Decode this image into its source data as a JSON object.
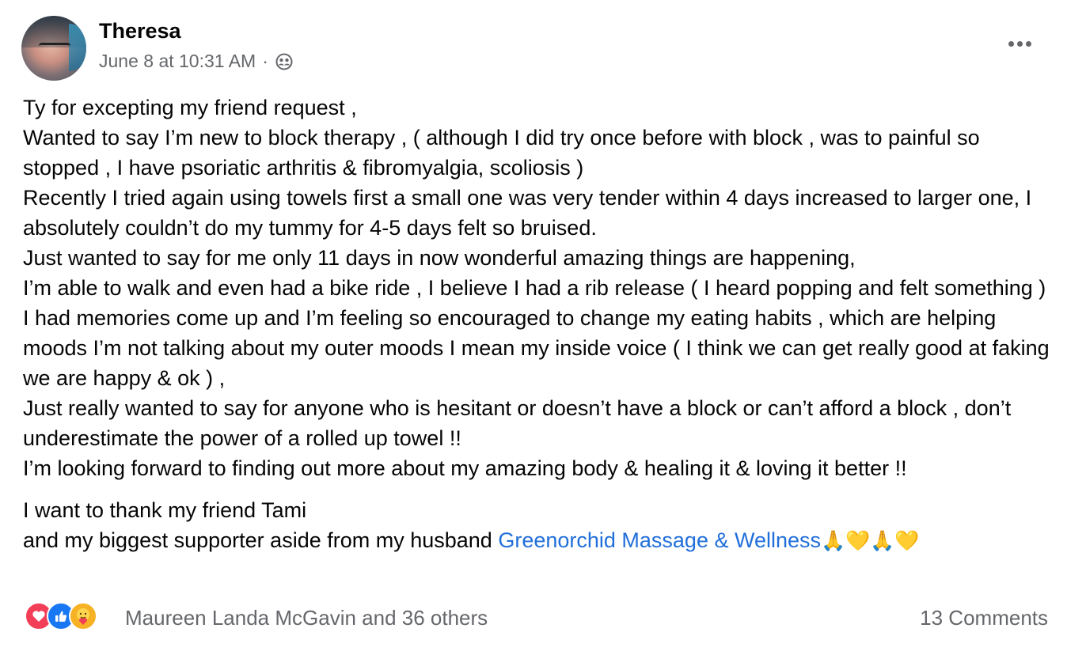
{
  "header": {
    "author": "Theresa",
    "timestamp": "June 8 at 10:31 AM",
    "separator": "·",
    "audience_icon": "friends-icon",
    "more_icon": "more-options-icon"
  },
  "body": {
    "lines": [
      "Ty for excepting my friend request ,",
      "Wanted to say I’m new to block therapy , ( although I did try once before with block , was to painful so stopped , I have psoriatic arthritis & fibromyalgia, scoliosis )",
      "Recently I tried again using towels first a small one was very tender within 4 days increased to larger one, I absolutely couldn’t do my tummy for 4-5 days felt so bruised.",
      "Just wanted to say for me only 11 days in now wonderful amazing things are happening,",
      "I’m able to walk and even had a bike ride , I believe I had a rib release ( I heard popping and felt something )",
      "I had memories come up and I’m feeling so encouraged to change my eating habits , which are helping moods I’m not talking about my outer moods I mean my inside voice ( I think we can get really good at faking we are happy & ok ) ,",
      "Just really wanted to say for anyone who is hesitant or doesn’t have a block or can’t afford a block , don’t underestimate the power of a rolled up towel !!",
      "I’m looking forward to finding out more about my amazing body & healing it & loving it better !!"
    ],
    "thanks_line": "I want to thank my friend Tami",
    "supporter_prefix": "and my biggest supporter aside from my husband ",
    "mention": "Greenorchid Massage & Wellness",
    "emojis": "🙏💛🙏💛"
  },
  "footer": {
    "reaction_icons": [
      "love-reaction-icon",
      "like-reaction-icon",
      "care-reaction-icon"
    ],
    "reaction_names": "Maureen Landa McGavin and 36 others",
    "comments": "13 Comments"
  },
  "colors": {
    "text": "#050505",
    "secondary": "#65676b",
    "link": "#216fdb",
    "love": "#f33e58",
    "like": "#1877f2",
    "care": "#f7b125"
  }
}
